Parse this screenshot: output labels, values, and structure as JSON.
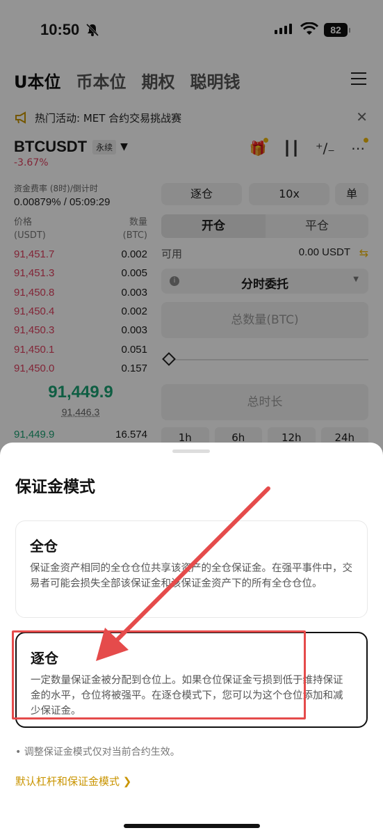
{
  "status_bar": {
    "time": "10:50",
    "battery": "82"
  },
  "nav": {
    "tabs": [
      "U本位",
      "币本位",
      "期权",
      "聪明钱"
    ]
  },
  "promo": {
    "text": "热门活动: MET 合约交易挑战赛"
  },
  "pair": {
    "name": "BTCUSDT",
    "tag": "永续",
    "change": "-3.67%"
  },
  "funding": {
    "label": "资金费率 (8时)/倒计时",
    "value": "0.00879% / 05:09:29"
  },
  "orderbook": {
    "price_label": "价格",
    "price_unit": "(USDT)",
    "qty_label": "数量",
    "qty_unit": "(BTC)",
    "asks": [
      {
        "price": "91,451.7",
        "qty": "0.002"
      },
      {
        "price": "91,451.3",
        "qty": "0.005"
      },
      {
        "price": "91,450.8",
        "qty": "0.003"
      },
      {
        "price": "91,450.4",
        "qty": "0.002"
      },
      {
        "price": "91,450.3",
        "qty": "0.003"
      },
      {
        "price": "91,450.1",
        "qty": "0.051"
      },
      {
        "price": "91,450.0",
        "qty": "0.157"
      }
    ],
    "last_price": "91,449.9",
    "mark_price": "91,446.3",
    "bid": {
      "price": "91,449.9",
      "qty": "16.574"
    }
  },
  "trade_panel": {
    "margin_mode": "逐仓",
    "leverage": "10x",
    "position_mode": "单",
    "tab_open": "开仓",
    "tab_close": "平仓",
    "available_label": "可用",
    "available_value": "0.00 USDT",
    "order_type": "分时委托",
    "qty_placeholder": "总数量(BTC)",
    "duration_placeholder": "总时长",
    "durations": [
      "1h",
      "6h",
      "12h",
      "24h"
    ]
  },
  "sheet": {
    "title": "保证金模式",
    "cross": {
      "title": "全仓",
      "desc": "保证金资产相同的全仓仓位共享该资产的全仓保证金。在强平事件中，交易者可能会损失全部该保证金和该保证金资产下的所有全仓仓位。"
    },
    "isolated": {
      "title": "逐仓",
      "desc": "一定数量保证金被分配到仓位上。如果仓位保证金亏损到低于维持保证金的水平，仓位将被强平。在逐仓模式下，您可以为这个仓位添加和减少保证金。"
    },
    "note": "• 调整保证金模式仅对当前合约生效。",
    "link": "默认杠杆和保证金模式 ❯"
  },
  "colors": {
    "ask": "#e0415f",
    "bid": "#1aa374",
    "accent": "#f0b90b",
    "annotation": "#e54b4b"
  }
}
